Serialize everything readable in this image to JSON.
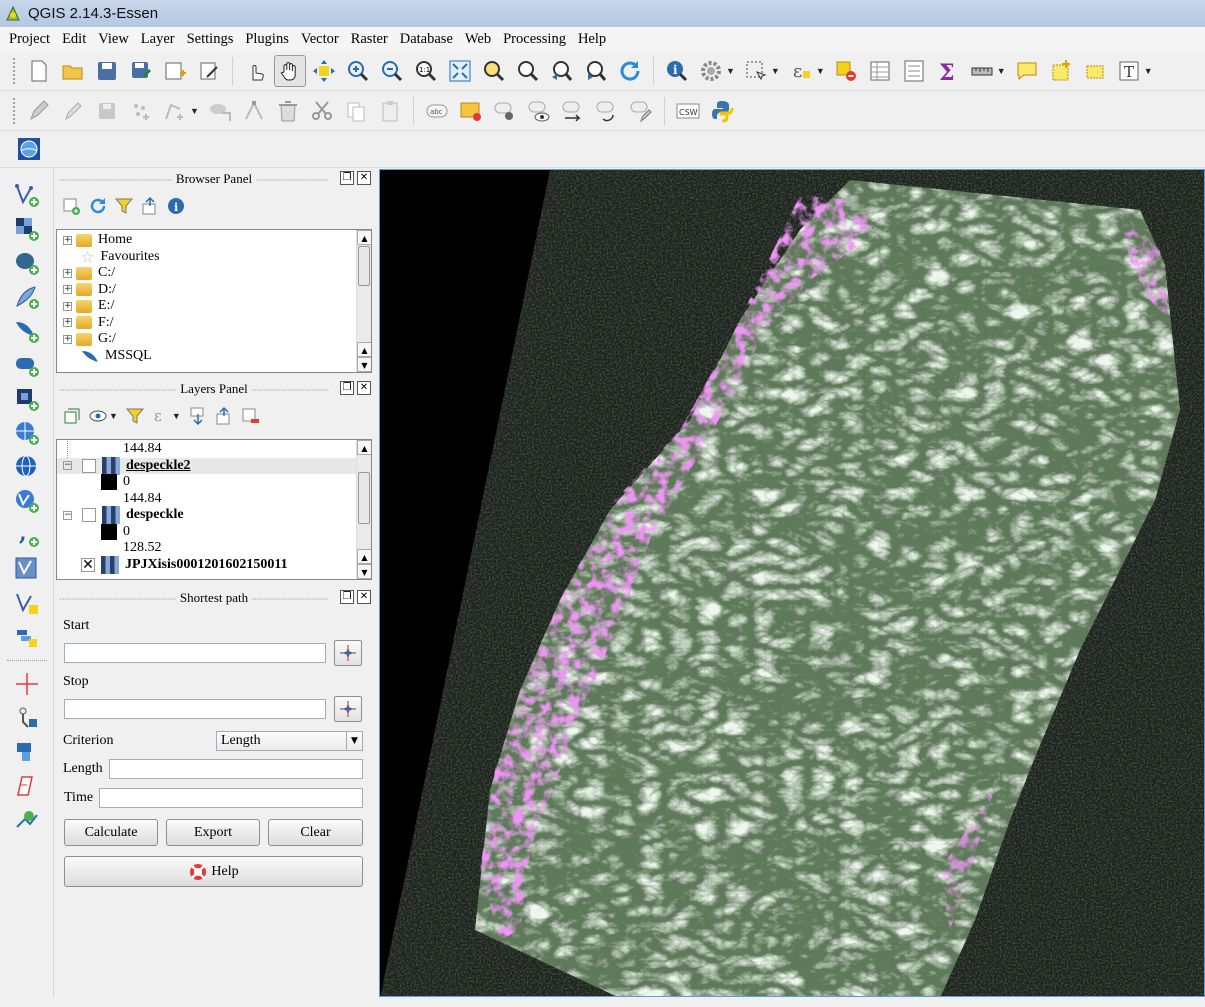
{
  "window": {
    "title": "QGIS 2.14.3-Essen"
  },
  "menu": [
    "Project",
    "Edit",
    "View",
    "Layer",
    "Settings",
    "Plugins",
    "Vector",
    "Raster",
    "Database",
    "Web",
    "Processing",
    "Help"
  ],
  "toolbar2": {
    "csw_label": "CSW",
    "abc_label": "abc"
  },
  "browser_panel": {
    "title": "Browser Panel",
    "items": [
      "Home",
      "Favourites",
      "C:/",
      "D:/",
      "E:/",
      "F:/",
      "G:/",
      "MSSQL"
    ]
  },
  "layers_panel": {
    "title": "Layers Panel",
    "rows": [
      {
        "value": "144.84"
      },
      {
        "layer": "despeckle2"
      },
      {
        "value": "0"
      },
      {
        "value": "144.84"
      },
      {
        "layer": "despeckle"
      },
      {
        "value": "0"
      },
      {
        "value": "128.52"
      },
      {
        "layer": "JPJXisis0001201602150011"
      }
    ]
  },
  "shortest_path": {
    "title": "Shortest path",
    "start_label": "Start",
    "stop_label": "Stop",
    "criterion_label": "Criterion",
    "criterion_value": "Length",
    "length_label": "Length",
    "time_label": "Time",
    "calculate_label": "Calculate",
    "export_label": "Export",
    "clear_label": "Clear",
    "help_label": "Help"
  },
  "colors": {
    "titlebar": "#b4c8e2",
    "canvas_background": "#000000",
    "canvas_border": "#5aa0e0",
    "raster_vegetation": "#5f7a5a",
    "raster_urban": "#d04ad8"
  }
}
